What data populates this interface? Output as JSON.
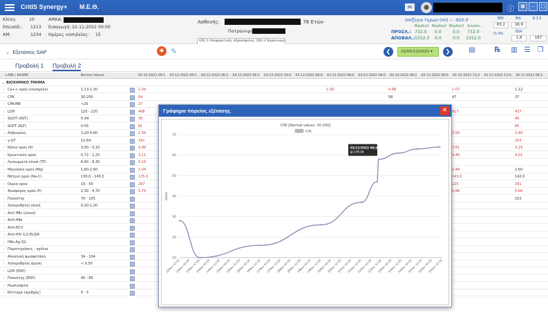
{
  "app": {
    "brand": "CritIS Synergy+",
    "ward": "Μ.Ε.Θ."
  },
  "patient": {
    "bed_label": "Κλίνη:",
    "bed_value": "10",
    "amka_label": "ΑΜΚΑ:",
    "episode_label": "Επεισόδ.:",
    "episode_value": "1213",
    "admission_label": "Εισαγωγή:",
    "admission_value": "22-11-2022 00:00",
    "am_label": "ΑΜ:",
    "am_value": "1234",
    "days_label": "Ημέρες νοσηλείας:",
    "days_value": "15",
    "patient_label": "Ασθενής:",
    "age_value": ", 76 Ετών",
    "father_label": "Πατρώνυμο:",
    "diagnosis": "G91.1 Αποφρακτικός υδροκέφαλος, D62.2 Καρκίνωμα in situ: Βρ..."
  },
  "balance": {
    "title": "Ισοζύγιο Υγρων (ml) ~ -820.0",
    "col1": "Βάρδια1",
    "col2": "Βάρδια2",
    "col3": "Βάρδια3",
    "col4": "Σύνολο...",
    "in_label": "ΠΡΟΣΛ.:",
    "in_values": [
      "732.0",
      "0.0",
      "0.0",
      "732.0"
    ],
    "out_label": "ΑΠΟΒΑΛ.:",
    "out_values": [
      "1552.0",
      "0.0",
      "0.0",
      "1552.0"
    ],
    "bmi_label": "BMI",
    "bmi_value": "63.2",
    "bw_label": "BW",
    "bw_value": "26.9",
    "bsa_label": "BSA",
    "bsa_value": "1.8",
    "o2_label": "O₂ Rh:",
    "extra_label": "Β.Σ.Ε",
    "extra_value": "167"
  },
  "toolbar": {
    "exams_label": "Εξετάσεις SAP",
    "date_value": "15/05/12/2022"
  },
  "tabs": [
    "Προβολή 1",
    "Προβολή 2"
  ],
  "grid": {
    "col_exams": "LABS / EXAMS",
    "col_normal": "Normal Values",
    "date_headers": [
      "05-12-2022 09:1",
      "05-12-2022 09:1",
      "04-12-2022 06:2",
      "04-12-2022 06:1",
      "03-12-2022 19:4",
      "03-12-2022 08:0",
      "03-12-2022 08:0",
      "03-12-2022 08:0",
      "02-12-2022 08:2",
      "02-12-2022 08:0",
      "01-12-2022 13:2",
      "01-12-2022 13:0",
      "30-11-2022 06:1"
    ],
    "section": "ΒΙΟΧΗΜΙΚΟ ΤΜΗΜΑ",
    "rows": [
      {
        "name": "Ca++ ορού (ιονισμένο)",
        "norm": "1,13-1,30",
        "first": "1.04",
        "mid": "1.00",
        "c8": "0.98",
        "c11": "1.07",
        "c13": "1.12"
      },
      {
        "name": "CPK",
        "norm": "30-200",
        "first": "64",
        "mid": "",
        "c8": "58",
        "c11": "47",
        "c13": "37"
      },
      {
        "name": "CPK-MB",
        "norm": "<25",
        "first": "27",
        "mid": "",
        "c8": "",
        "c11": "",
        "c13": ""
      },
      {
        "name": "LDH",
        "norm": "125 - 220",
        "first": "498",
        "mid": "",
        "c8": "",
        "c11": "417",
        "c13": "437"
      },
      {
        "name": "SGOT (AST)",
        "norm": "5-34",
        "first": "30",
        "mid": "",
        "c8": "",
        "c11": "",
        "c13": "40"
      },
      {
        "name": "SGPT (ALT)",
        "norm": "0-55",
        "first": "61",
        "mid": "",
        "c8": "",
        "c11": "",
        "c13": "85"
      },
      {
        "name": "Αλβουμίνη",
        "norm": "3,20-4,60",
        "first": "2.39",
        "mid": "",
        "c8": "",
        "c11": "2.58",
        "c13": "2.49"
      },
      {
        "name": "γ-GT",
        "norm": "12-64",
        "first": "181",
        "mid": "",
        "c8": "",
        "c11": "",
        "c13": "203"
      },
      {
        "name": "Κάλιο ορού (K)",
        "norm": "3,50 - 5,10",
        "first": "3.00",
        "mid": "",
        "c8": "",
        "c11": "3.81",
        "c13": "3.19"
      },
      {
        "name": "Κρεατινίνη ορού",
        "norm": "0,72 - 1,25",
        "first": "3.11",
        "mid": "",
        "c8": "",
        "c11": "3.46",
        "c13": "4.01"
      },
      {
        "name": "Λευκώματα ολικά (TP)",
        "norm": "6,40 - 8,30",
        "first": "4.16",
        "mid": "",
        "c8": "",
        "c11": "",
        "c13": ""
      },
      {
        "name": "Μαγνήσιο ορού (Mg)",
        "norm": "1,60-2,60",
        "first": "2.04",
        "mid": "",
        "c8": "",
        "c11": "2.48",
        "c13": "2.60"
      },
      {
        "name": "Νάτριο ορού (Na-C)",
        "norm": "136,0 - 145,0",
        "first": "135.0",
        "mid": "",
        "c8": "",
        "c11": "143.0",
        "c13": "142.0"
      },
      {
        "name": "Ουρία ορού",
        "norm": "19 - 50",
        "first": "297",
        "mid": "",
        "c8": "",
        "c11": "225",
        "c13": "291"
      },
      {
        "name": "Φωσφόρος ορού (P)",
        "norm": "2,30 - 4,70",
        "first": "5.79",
        "mid": "",
        "c8": "",
        "c11": "5.88",
        "c13": "5.66"
      },
      {
        "name": "Πυκνότης",
        "norm": "70 - 105",
        "first": "",
        "mid": "",
        "c8": "",
        "c11": "",
        "c13": "102"
      },
      {
        "name": "Χολερυθρίνη ολική",
        "norm": "0,20-1,20",
        "first": "",
        "mid": "",
        "c8": "",
        "c11": "",
        "c13": ""
      },
      {
        "name": "Anti HBc (ολικό)",
        "norm": "",
        "first": "",
        "mid": "",
        "c8": "",
        "c11": "",
        "c13": ""
      },
      {
        "name": "Anti-HBs",
        "norm": "",
        "first": "",
        "mid": "",
        "c8": "",
        "c11": "",
        "c13": ""
      },
      {
        "name": "Anti-HCV",
        "norm": "",
        "first": "",
        "mid": "",
        "c8": "",
        "c11": "",
        "c13": ""
      },
      {
        "name": "Anti-HIV 1/2-ELISA",
        "norm": "",
        "first": "",
        "mid": "",
        "c8": "",
        "c11": "",
        "c13": ""
      },
      {
        "name": "HBs-Ag Q2",
        "norm": "",
        "first": "",
        "mid": "",
        "c8": "",
        "c11": "",
        "c13": ""
      },
      {
        "name": "Παρατηρήσεις - σχόλια",
        "norm": "",
        "first": "",
        "mid": "",
        "c8": "",
        "c11": "",
        "c13": ""
      },
      {
        "name": "Αλκαλική φωσφατάση",
        "norm": "34 - 104",
        "first": "",
        "mid": "",
        "c8": "",
        "c11": "",
        "c13": ""
      },
      {
        "name": "Χολερυθρίνη άμεση",
        "norm": "< 0,50",
        "first": "",
        "mid": "",
        "c8": "",
        "c11": "",
        "c13": ""
      },
      {
        "name": "LDH (ENY)",
        "norm": "",
        "first": "",
        "mid": "",
        "c8": "",
        "c11": "",
        "c13": ""
      },
      {
        "name": "Πυκνότης (ENY)",
        "norm": "40 - 80",
        "first": "",
        "mid": "",
        "c8": "",
        "c11": "",
        "c13": ""
      },
      {
        "name": "Ηωσινόφιλα",
        "norm": "",
        "first": "",
        "mid": "",
        "c8": "",
        "c11": "",
        "c13": ""
      },
      {
        "name": "Κύτταρα (αριθμός)",
        "norm": "0 - 5",
        "first": "",
        "mid": "",
        "c8": "",
        "c11": "",
        "c13": ""
      }
    ]
  },
  "modal": {
    "title": "Γράφημα πορείας εξέτασης",
    "close": "✕"
  },
  "chart_data": {
    "type": "line",
    "title": "CPK [Normal values: 30-200]",
    "ylabel": "Value",
    "xlabel": "",
    "legend": "top-center",
    "grid": true,
    "ylim": [
      10,
      70
    ],
    "yticks": [
      10,
      20,
      30,
      40,
      50,
      60,
      70
    ],
    "series": [
      {
        "name": "CPK",
        "color": "#8f8fb6"
      }
    ],
    "x": [
      "22Nov 12:00",
      "23Nov 00:00",
      "23Nov 12:00",
      "24Nov 00:00",
      "24Nov 12:00",
      "25Nov 00:00",
      "25Nov 12:00",
      "26Nov 00:00",
      "26Nov 12:00",
      "27Nov 00:00",
      "27Nov 12:00",
      "28Nov 00:00",
      "28Nov 12:00",
      "29Nov 00:00",
      "29Nov 12:00",
      "30Nov 00:00",
      "30Nov 12:00",
      "01Dec 00:00",
      "01Dec 12:00",
      "02Dec 00:00",
      "02Dec 12:00",
      "03Dec 00:00",
      "03Dec 12:00",
      "04Dec 00:00",
      "04Dec 12:00",
      "05Dec 00:00",
      "05Dec 12:00"
    ],
    "points": [
      {
        "x": "22Nov 12:00",
        "y": 28
      },
      {
        "x": "23Nov 12:00",
        "y": 10
      },
      {
        "x": "26Nov 12:00",
        "y": 16
      },
      {
        "x": "29Nov 12:00",
        "y": 26
      },
      {
        "x": "01Dec 12:00",
        "y": 37
      },
      {
        "x": "02Dec 06:30",
        "y": 47
      },
      {
        "x": "02Dec 08:26",
        "y": 58
      },
      {
        "x": "03Dec 08:00",
        "y": 61
      },
      {
        "x": "04Dec 06:00",
        "y": 63
      },
      {
        "x": "05Dec 09:00",
        "y": 64
      }
    ],
    "tooltip": {
      "date": "02/12/2022 08:26",
      "series": "CPK",
      "value": "58"
    }
  }
}
